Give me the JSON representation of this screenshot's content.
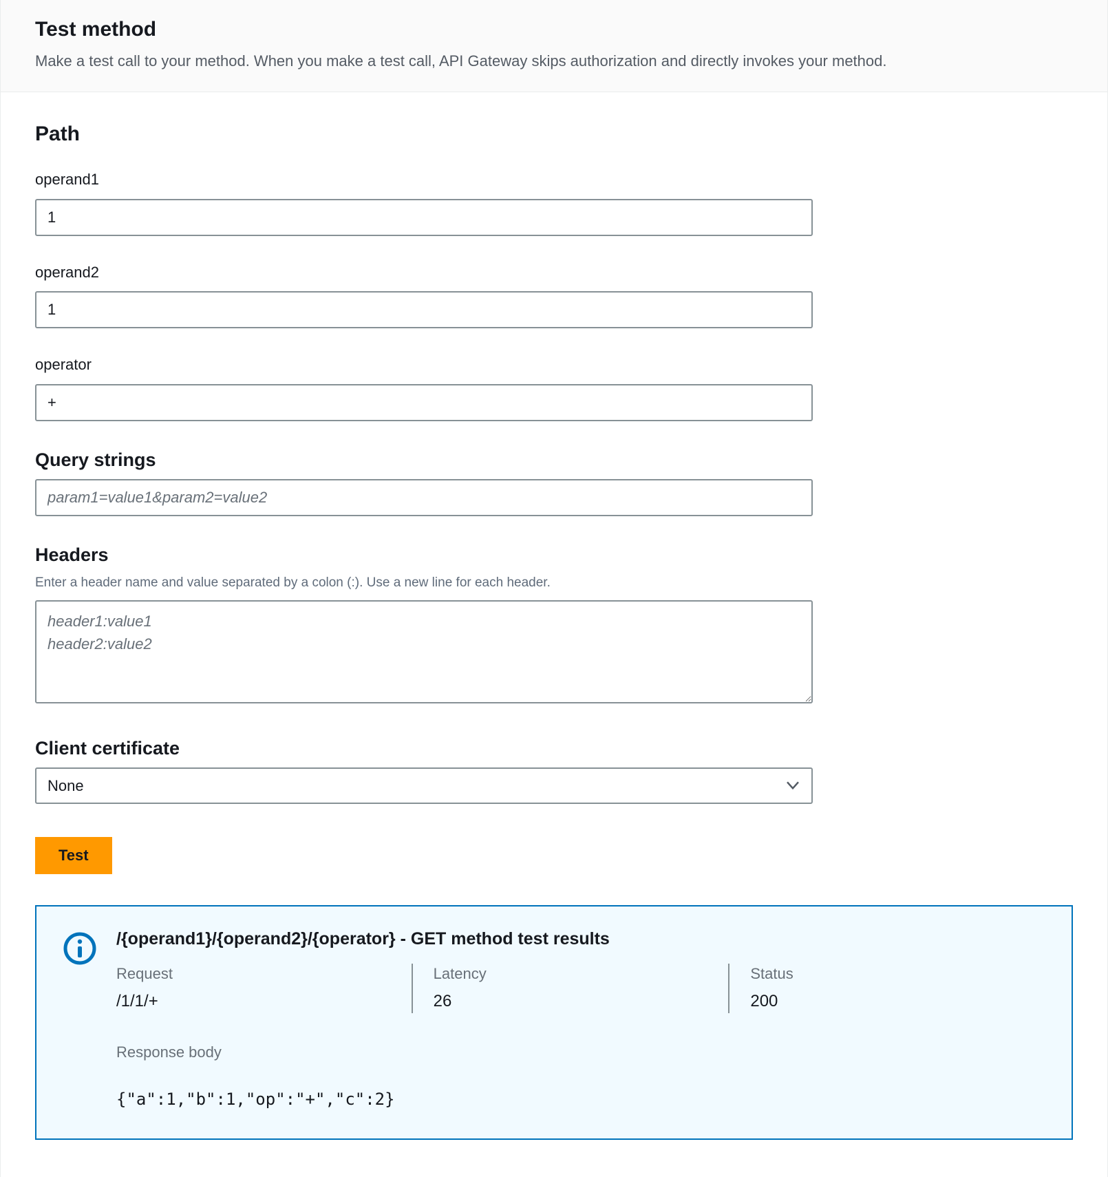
{
  "header": {
    "title": "Test method",
    "description": "Make a test call to your method. When you make a test call, API Gateway skips authorization and directly invokes your method."
  },
  "path": {
    "heading": "Path",
    "fields": [
      {
        "label": "operand1",
        "value": "1"
      },
      {
        "label": "operand2",
        "value": "1"
      },
      {
        "label": "operator",
        "value": "+"
      }
    ]
  },
  "query_strings": {
    "heading": "Query strings",
    "placeholder": "param1=value1&param2=value2",
    "value": ""
  },
  "headers": {
    "heading": "Headers",
    "hint": "Enter a header name and value separated by a colon (:). Use a new line for each header.",
    "placeholder": "header1:value1\nheader2:value2",
    "value": ""
  },
  "client_certificate": {
    "heading": "Client certificate",
    "selected": "None",
    "options": [
      "None"
    ]
  },
  "actions": {
    "test_label": "Test"
  },
  "results": {
    "title": "/{operand1}/{operand2}/{operator} - GET method test results",
    "columns": [
      {
        "label": "Request",
        "value": "/1/1/+"
      },
      {
        "label": "Latency",
        "value": "26"
      },
      {
        "label": "Status",
        "value": "200"
      }
    ],
    "response_body_label": "Response body",
    "response_body": "{\"a\":1,\"b\":1,\"op\":\"+\",\"c\":2}"
  }
}
